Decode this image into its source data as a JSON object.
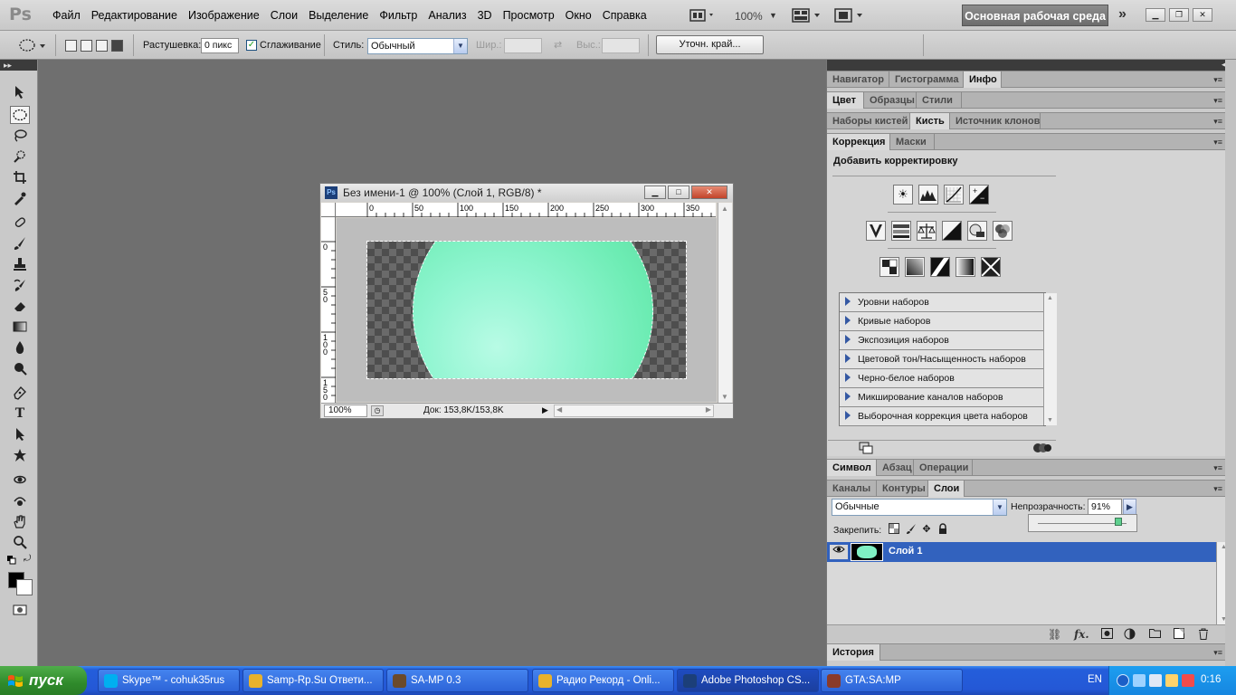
{
  "app": {
    "logo": "Ps"
  },
  "menu": [
    "Файл",
    "Редактирование",
    "Изображение",
    "Слои",
    "Выделение",
    "Фильтр",
    "Анализ",
    "3D",
    "Просмотр",
    "Окно",
    "Справка"
  ],
  "menubar": {
    "zoom": "100%",
    "workspace": "Основная рабочая среда",
    "more": "»"
  },
  "options": {
    "feather_label": "Растушевка:",
    "feather_value": "0 пикс",
    "antialias_label": "Сглаживание",
    "antialias_checked": true,
    "style_label": "Стиль:",
    "style_value": "Обычный",
    "width_label": "Шир.:",
    "height_label": "Выс.:",
    "refine_edge": "Уточн. край..."
  },
  "document": {
    "title": "Без имени-1 @ 100% (Слой 1, RGB/8) *",
    "ps_icon": "Ps",
    "ruler_top": [
      "0",
      "50",
      "100",
      "150",
      "200",
      "250",
      "300",
      "350"
    ],
    "ruler_left": [
      "0",
      "50",
      "100",
      "150"
    ],
    "zoom": "100%",
    "doc_info": "Док: 153,8K/153,8K"
  },
  "panels": {
    "group1": [
      "Навигатор",
      "Гистограмма",
      "Инфо"
    ],
    "group1_active": 2,
    "group2": [
      "Цвет",
      "Образцы",
      "Стили"
    ],
    "group2_active": 0,
    "group3": [
      "Наборы кистей",
      "Кисть",
      "Источник клонов"
    ],
    "group3_active": 1,
    "group4": [
      "Коррекция",
      "Маски"
    ],
    "group4_active": 0,
    "adjust_title": "Добавить корректировку",
    "presets": [
      "Уровни наборов",
      "Кривые наборов",
      "Экспозиция наборов",
      "Цветовой тон/Насыщенность наборов",
      "Черно-белое наборов",
      "Микширование каналов наборов",
      "Выборочная коррекция цвета наборов"
    ],
    "group5": [
      "Символ",
      "Абзац",
      "Операции"
    ],
    "group5_active": 0,
    "group6": [
      "Каналы",
      "Контуры",
      "Слои"
    ],
    "group6_active": 2,
    "blend_mode": "Обычные",
    "opacity_label": "Непрозрачность:",
    "opacity_value": "91%",
    "opacity_fraction": 0.91,
    "lock_label": "Закрепить:",
    "layer_name": "Слой 1",
    "history": "История"
  },
  "taskbar": {
    "start": "пуск",
    "tasks": [
      {
        "label": "Skype™ - cohuk35rus",
        "color": "#00aff0"
      },
      {
        "label": "Samp-Rp.Su Ответи...",
        "color": "#e8b22c"
      },
      {
        "label": "SA-MP 0.3",
        "color": "#6b4a2b"
      },
      {
        "label": "Радио Рекорд - Onli...",
        "color": "#e8b22c"
      },
      {
        "label": "Adobe Photoshop CS...",
        "color": "#1c3f79"
      },
      {
        "label": "GTA:SA:MP",
        "color": "#8a3b2b"
      }
    ],
    "active_task": 4,
    "lang": "EN",
    "clock": "0:16"
  },
  "colors": {
    "ellipse_fill": "#7ff0c4",
    "layer_selected": "#3262be",
    "taskbar": "#245edb",
    "start": "#2f8a2b"
  }
}
